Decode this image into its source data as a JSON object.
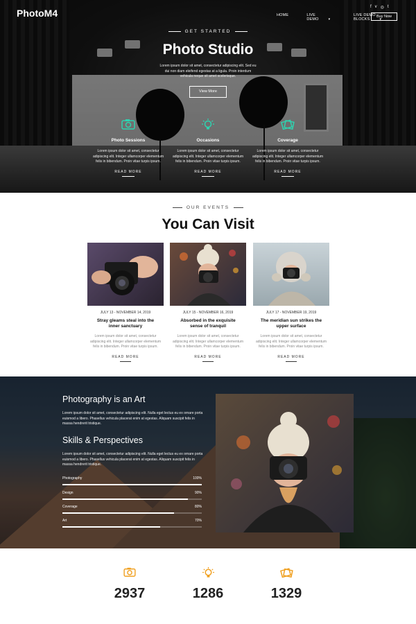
{
  "brand": {
    "logo": "PhotoM4"
  },
  "nav": {
    "items": [
      {
        "label": "HOME",
        "dropdown": false
      },
      {
        "label": "LIVE DEMO",
        "dropdown": true
      },
      {
        "label": "LIVE DEMO BLOCKS",
        "dropdown": true
      }
    ],
    "buy_label": "Buy Now",
    "social_icons": [
      "facebook-icon",
      "vimeo-icon",
      "instagram-icon",
      "twitter-icon"
    ]
  },
  "hero": {
    "eyebrow": "GET STARTED",
    "title": "Photo Studio",
    "subtitle": "Lorem ipsum dolor sit amet, consectetur adipiscing elit. Sed eu dui non diam eleifend egestas at a ligula. Proin interdum vehicula neque sit amet scelerisque.",
    "button": "View More",
    "features": [
      {
        "icon": "camera-icon",
        "title": "Photo Sessions",
        "text": "Lorem ipsum dolor sit amet, consectetur adipiscing elit. Integer ullamcorper elementum felis in bibendum. Proin vitae turpis ipsum.",
        "more": "READ MORE"
      },
      {
        "icon": "lightbulb-icon",
        "title": "Occasions",
        "text": "Lorem ipsum dolor sit amet, consectetur adipiscing elit. Integer ullamcorper elementum felis in bibendum. Proin vitae turpis ipsum.",
        "more": "READ MORE"
      },
      {
        "icon": "photos-icon",
        "title": "Coverage",
        "text": "Lorem ipsum dolor sit amet, consectetur adipiscing elit. Integer ullamcorper elementum felis in bibendum. Proin vitae turpis ipsum.",
        "more": "READ MORE"
      }
    ],
    "accent": "#2ed3b0"
  },
  "events": {
    "eyebrow": "OUR EVENTS",
    "title": "You Can Visit",
    "cards": [
      {
        "date": "JULY 13 - NOVEMBER 14, 2019",
        "title": "Stray gleams steal into the inner sanctuary",
        "text": "Lorem ipsum dolor sit amet, consectetur adipiscing elit. Integer ullamcorper elementum felis in bibendum. Proin vitae turpis ipsum.",
        "more": "READ MORE"
      },
      {
        "date": "JULY 15 - NOVEMBER 16, 2019",
        "title": "Absorbed in the exquisite sense of tranquil",
        "text": "Lorem ipsum dolor sit amet, consectetur adipiscing elit. Integer ullamcorper elementum felis in bibendum. Proin vitae turpis ipsum.",
        "more": "READ MORE"
      },
      {
        "date": "JULY 17 - NOVEMBER 19, 2019",
        "title": "The meridian sun strikes the upper surface",
        "text": "Lorem ipsum dolor sit amet, consectetur adipiscing elit. Integer ullamcorper elementum felis in bibendum. Proin vitae turpis ipsum.",
        "more": "READ MORE"
      }
    ]
  },
  "art": {
    "title": "Photography is an Art",
    "text1": "Lorem ipsum dolor sit amet, consectetur adipiscing elit. Nulla eget lectus eu ex ornare porta euismod a libero. Phasellus vehicula placerat enim at egestas. Aliquam suscipit felis in massa hendrerit tristique.",
    "skills_title": "Skills & Perspectives",
    "text2": "Lorem ipsum dolor sit amet, consectetur adipiscing elit. Nulla eget lectus eu ex ornare porta euismod a libero. Phasellus vehicula placerat enim at egestas. Aliquam suscipit felis in massa hendrerit tristique.",
    "skills": [
      {
        "name": "Photography",
        "value": "100%",
        "fraction": 1.0
      },
      {
        "name": "Design",
        "value": "90%",
        "fraction": 0.9
      },
      {
        "name": "Coverage",
        "value": "80%",
        "fraction": 0.8
      },
      {
        "name": "Art",
        "value": "70%",
        "fraction": 0.7
      }
    ]
  },
  "stats": {
    "accent": "#f0a020",
    "items": [
      {
        "icon": "camera-icon",
        "value": "2937"
      },
      {
        "icon": "lightbulb-icon",
        "value": "1286"
      },
      {
        "icon": "photos-icon",
        "value": "1329"
      }
    ]
  }
}
